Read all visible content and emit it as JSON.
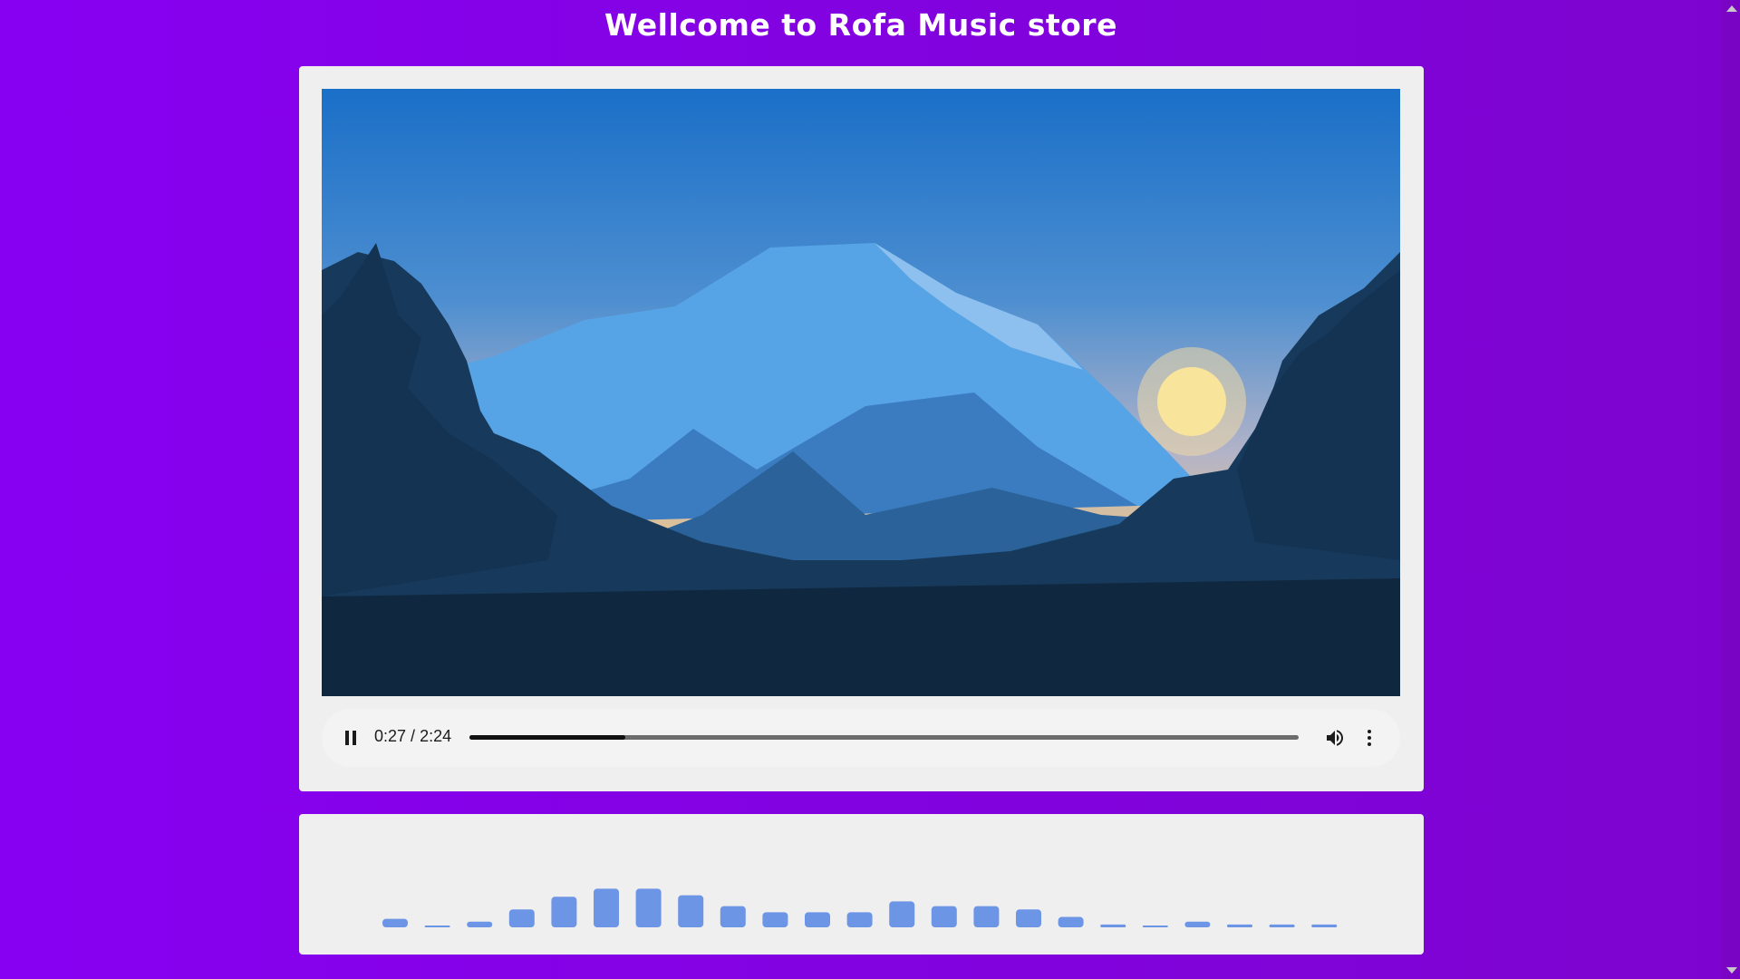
{
  "page": {
    "title": "Wellcome to Rofa Music store"
  },
  "player": {
    "state": "playing",
    "current_time": "0:27",
    "separator": " / ",
    "duration": "2:24",
    "progress_fraction": 0.1875,
    "icons": {
      "play_pause": "pause-icon",
      "volume": "volume-icon",
      "more": "more-vertical-icon"
    },
    "poster": "mountain landscape illustration"
  },
  "visualizer": {
    "bar_color": "#6d95e6",
    "levels": [
      0.18,
      0.02,
      0.12,
      0.38,
      0.65,
      0.82,
      0.82,
      0.68,
      0.45,
      0.32,
      0.32,
      0.32,
      0.55,
      0.45,
      0.45,
      0.38,
      0.22,
      0.06,
      0.02,
      0.12,
      0.06,
      0.06,
      0.06
    ]
  },
  "colors": {
    "background_left": "#8800f2",
    "background_right": "#7d04cf",
    "card": "#efefef"
  }
}
